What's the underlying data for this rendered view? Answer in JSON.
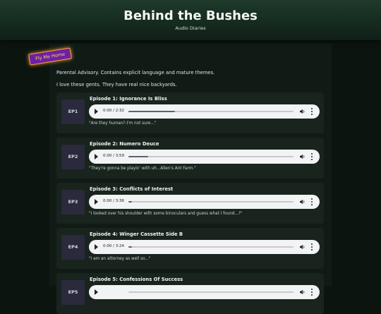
{
  "header": {
    "title": "Behind the Bushes",
    "subtitle": "Audio Diaries"
  },
  "fly_button": {
    "label": "Fly Me Home"
  },
  "notes": [
    "Parental Advisory. Contains explicit language and mature themes.",
    "I love these gents. They have real nice backyards."
  ],
  "episodes": [
    {
      "badge": "EP1",
      "title": "Episode 1: Ignorance Is Bliss",
      "time": "0:00 / 2:32",
      "progress": 0.28,
      "quote": "\"Are they human?-I'm not sure...\""
    },
    {
      "badge": "EP2",
      "title": "Episode 2: Numero Deuce",
      "time": "0:00 / 3:59",
      "progress": 0.12,
      "quote": "\"They're gonna be playin' with uh...Allen's Ant Farm.\""
    },
    {
      "badge": "EP3",
      "title": "Episode 3: Conflicts of Interest",
      "time": "0:00 / 3:36",
      "progress": 0.02,
      "quote": "\"I looked over his shoulder with some binoculars and guess what I found...?\""
    },
    {
      "badge": "EP4",
      "title": "Episode 4: Winger Cassette Side B",
      "time": "0:00 / 3:24",
      "progress": 0.02,
      "quote": "\"I am an attorney as well so...\""
    },
    {
      "badge": "EP5",
      "title": "Episode 5: Confessions Of Success",
      "time": "",
      "progress": 0,
      "quote": ""
    }
  ]
}
